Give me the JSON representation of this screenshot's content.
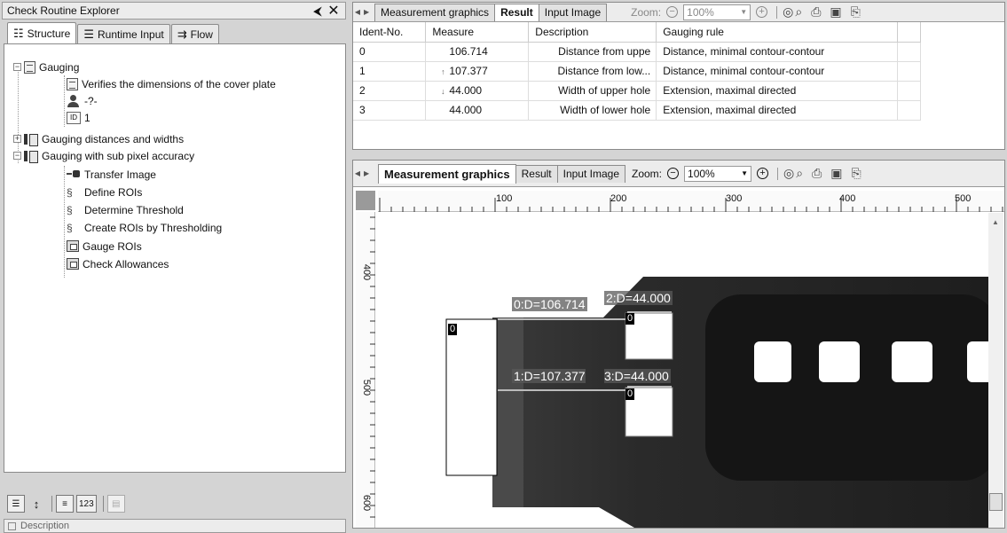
{
  "left_panel": {
    "title": "Check Routine Explorer",
    "tabs": [
      {
        "label": "Structure",
        "active": true
      },
      {
        "label": "Runtime Input",
        "active": false
      },
      {
        "label": "Flow",
        "active": false
      }
    ],
    "tree": {
      "root": "Gauging",
      "root_children": [
        "Verifies the dimensions of the cover plate",
        "-?-",
        "1"
      ],
      "folders": [
        {
          "label": "Gauging distances and widths",
          "expanded": false
        },
        {
          "label": "Gauging with sub pixel accuracy",
          "expanded": true,
          "items": [
            "Transfer Image",
            "Define ROIs",
            "Determine Threshold",
            "Create ROIs by Thresholding",
            "Gauge ROIs",
            "Check Allowances"
          ]
        }
      ]
    },
    "description_label": "Description"
  },
  "result_panel": {
    "tabs": [
      {
        "label": "Measurement graphics",
        "active": false
      },
      {
        "label": "Result",
        "active": true
      },
      {
        "label": "Input Image",
        "active": false
      }
    ],
    "zoom_label": "Zoom:",
    "zoom_value": "100%",
    "columns": [
      "Ident-No.",
      "Measure",
      "Description",
      "Gauging rule"
    ],
    "rows": [
      {
        "id": "0",
        "trend": "",
        "measure": "106.714",
        "description": "Distance from uppe",
        "rule": "Distance, minimal contour-contour"
      },
      {
        "id": "1",
        "trend": "up",
        "measure": "107.377",
        "description": "Distance from low...",
        "rule": "Distance, minimal contour-contour"
      },
      {
        "id": "2",
        "trend": "down",
        "measure": "44.000",
        "description": "Width of upper hole",
        "rule": "Extension, maximal directed"
      },
      {
        "id": "3",
        "trend": "",
        "measure": "44.000",
        "description": "Width of lower hole",
        "rule": "Extension, maximal directed"
      }
    ]
  },
  "graphics_panel": {
    "tabs": [
      {
        "label": "Measurement graphics",
        "active": true
      },
      {
        "label": "Result",
        "active": false
      },
      {
        "label": "Input Image",
        "active": false
      }
    ],
    "zoom_label": "Zoom:",
    "zoom_value": "100%",
    "hruler_labels": [
      "100",
      "200",
      "300",
      "400",
      "500"
    ],
    "vruler_labels": [
      "400",
      "500",
      "600"
    ],
    "measurements": {
      "m0": "0:D=106.714",
      "m2": "2:D=44.000",
      "m1": "1:D=107.377",
      "m3": "3:D=44.000",
      "roi_left": "0",
      "roi_upper": "0",
      "roi_lower": "0"
    }
  }
}
